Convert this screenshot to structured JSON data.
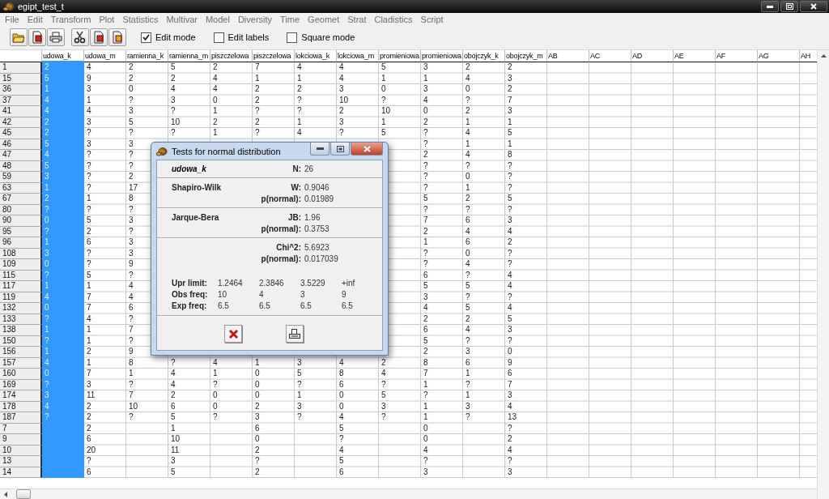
{
  "window": {
    "title": "egipt_test_t"
  },
  "menu": [
    "File",
    "Edit",
    "Transform",
    "Plot",
    "Statistics",
    "Multivar",
    "Model",
    "Diversity",
    "Time",
    "Geomet",
    "Strat",
    "Cladistics",
    "Script"
  ],
  "toolbar": {
    "checkboxes": [
      {
        "label": "Edit mode",
        "checked": true
      },
      {
        "label": "Edit labels",
        "checked": false
      },
      {
        "label": "Square mode",
        "checked": false
      }
    ]
  },
  "table": {
    "columns": [
      {
        "label": "udowa_k",
        "selected": true
      },
      {
        "label": "udowa_m",
        "selected": false
      },
      {
        "label": "ramienna_k",
        "selected": false
      },
      {
        "label": "ramienna_m",
        "selected": false
      },
      {
        "label": "piszczelowa",
        "selected": false
      },
      {
        "label": "piszczelowa",
        "selected": false
      },
      {
        "label": "lokciowa_k",
        "selected": false
      },
      {
        "label": "lokciowa_m",
        "selected": false
      },
      {
        "label": "promieniowa",
        "selected": false
      },
      {
        "label": "promieniowa",
        "selected": false
      },
      {
        "label": "obojczyk_k",
        "selected": false
      },
      {
        "label": "obojczyk_m",
        "selected": false
      },
      {
        "label": "AB",
        "selected": false
      },
      {
        "label": "AC",
        "selected": false
      },
      {
        "label": "AD",
        "selected": false
      },
      {
        "label": "AE",
        "selected": false
      },
      {
        "label": "AF",
        "selected": false
      },
      {
        "label": "AG",
        "selected": false
      },
      {
        "label": "AH",
        "selected": false
      }
    ],
    "rows": [
      {
        "label": "1",
        "cells": [
          "2",
          "4",
          "2",
          "5",
          "2",
          "7",
          "4",
          "4",
          "5",
          "3",
          "2",
          "2"
        ]
      },
      {
        "label": "15",
        "cells": [
          "5",
          "9",
          "2",
          "2",
          "4",
          "1",
          "1",
          "4",
          "1",
          "1",
          "4",
          "3"
        ]
      },
      {
        "label": "36",
        "cells": [
          "1",
          "3",
          "0",
          "4",
          "4",
          "2",
          "2",
          "3",
          "0",
          "3",
          "0",
          "2"
        ]
      },
      {
        "label": "37",
        "cells": [
          "4",
          "1",
          "?",
          "3",
          "0",
          "2",
          "?",
          "10",
          "?",
          "4",
          "?",
          "7"
        ]
      },
      {
        "label": "41",
        "cells": [
          "4",
          "4",
          "3",
          "?",
          "1",
          "?",
          "?",
          "2",
          "10",
          "0",
          "2",
          "3"
        ]
      },
      {
        "label": "42",
        "cells": [
          "2",
          "3",
          "5",
          "10",
          "2",
          "2",
          "1",
          "3",
          "1",
          "2",
          "1",
          "1"
        ]
      },
      {
        "label": "45",
        "cells": [
          "2",
          "?",
          "?",
          "?",
          "1",
          "?",
          "4",
          "?",
          "5",
          "?",
          "4",
          "5"
        ]
      },
      {
        "label": "46",
        "cells": [
          "5",
          "3",
          "3",
          null,
          null,
          null,
          null,
          null,
          null,
          "?",
          "1",
          "1"
        ]
      },
      {
        "label": "47",
        "cells": [
          "4",
          "?",
          "?",
          null,
          null,
          null,
          null,
          null,
          null,
          "2",
          "4",
          "8"
        ]
      },
      {
        "label": "48",
        "cells": [
          "5",
          "?",
          "?",
          null,
          null,
          null,
          null,
          null,
          null,
          "?",
          "?",
          "?"
        ]
      },
      {
        "label": "59",
        "cells": [
          "3",
          "?",
          "2",
          null,
          null,
          null,
          null,
          null,
          null,
          "?",
          "0",
          "?"
        ]
      },
      {
        "label": "63",
        "cells": [
          "1",
          "?",
          "17",
          null,
          null,
          null,
          null,
          null,
          null,
          "?",
          "1",
          "?"
        ]
      },
      {
        "label": "67",
        "cells": [
          "2",
          "1",
          "8",
          null,
          null,
          null,
          null,
          null,
          null,
          "5",
          "2",
          "5"
        ]
      },
      {
        "label": "80",
        "cells": [
          "?",
          "?",
          "?",
          null,
          null,
          null,
          null,
          null,
          null,
          "?",
          "?",
          "?"
        ]
      },
      {
        "label": "90",
        "cells": [
          "0",
          "5",
          "3",
          null,
          null,
          null,
          null,
          null,
          null,
          "7",
          "6",
          "3"
        ]
      },
      {
        "label": "95",
        "cells": [
          "?",
          "2",
          "?",
          null,
          null,
          null,
          null,
          null,
          null,
          "2",
          "4",
          "4"
        ]
      },
      {
        "label": "96",
        "cells": [
          "1",
          "6",
          "3",
          null,
          null,
          null,
          null,
          null,
          null,
          "1",
          "6",
          "2"
        ]
      },
      {
        "label": "108",
        "cells": [
          "3",
          "?",
          "3",
          null,
          null,
          null,
          null,
          null,
          null,
          "?",
          "0",
          "?"
        ]
      },
      {
        "label": "109",
        "cells": [
          "0",
          "?",
          "9",
          null,
          null,
          null,
          null,
          null,
          null,
          "?",
          "4",
          "?"
        ]
      },
      {
        "label": "115",
        "cells": [
          "?",
          "5",
          "?",
          null,
          null,
          null,
          null,
          null,
          null,
          "6",
          "?",
          "4"
        ]
      },
      {
        "label": "117",
        "cells": [
          "1",
          "1",
          "4",
          null,
          null,
          null,
          null,
          null,
          null,
          "5",
          "5",
          "4"
        ]
      },
      {
        "label": "119",
        "cells": [
          "4",
          "7",
          "4",
          null,
          null,
          null,
          null,
          null,
          null,
          "3",
          "?",
          "?"
        ]
      },
      {
        "label": "132",
        "cells": [
          "0",
          "7",
          "6",
          null,
          null,
          null,
          null,
          null,
          null,
          "4",
          "5",
          "4"
        ]
      },
      {
        "label": "133",
        "cells": [
          "?",
          "4",
          "?",
          null,
          null,
          null,
          null,
          null,
          null,
          "2",
          "2",
          "5"
        ]
      },
      {
        "label": "138",
        "cells": [
          "1",
          "1",
          "7",
          null,
          null,
          null,
          null,
          null,
          null,
          "6",
          "4",
          "3"
        ]
      },
      {
        "label": "150",
        "cells": [
          "?",
          "1",
          "?",
          null,
          null,
          null,
          null,
          null,
          null,
          "5",
          "?",
          "?"
        ]
      },
      {
        "label": "156",
        "cells": [
          "1",
          "2",
          "9",
          null,
          null,
          null,
          null,
          null,
          null,
          "2",
          "3",
          "0"
        ]
      },
      {
        "label": "157",
        "cells": [
          "4",
          "1",
          "8",
          "?",
          "4",
          "1",
          "3",
          "4",
          "2",
          "8",
          "6",
          "9"
        ]
      },
      {
        "label": "160",
        "cells": [
          "0",
          "7",
          "1",
          "4",
          "1",
          "0",
          "5",
          "8",
          "4",
          "7",
          "1",
          "6"
        ]
      },
      {
        "label": "169",
        "cells": [
          "?",
          "3",
          "?",
          "4",
          "?",
          "0",
          "?",
          "6",
          "?",
          "1",
          "?",
          "7"
        ]
      },
      {
        "label": "174",
        "cells": [
          "3",
          "11",
          "7",
          "2",
          "0",
          "0",
          "1",
          "0",
          "5",
          "?",
          "1",
          "3"
        ]
      },
      {
        "label": "178",
        "cells": [
          "4",
          "2",
          "10",
          "6",
          "0",
          "2",
          "3",
          "0",
          "3",
          "1",
          "3",
          "4"
        ]
      },
      {
        "label": "187",
        "cells": [
          "?",
          "2",
          "?",
          "5",
          "?",
          "3",
          "?",
          "4",
          "?",
          "1",
          "?",
          "13"
        ]
      },
      {
        "label": "7",
        "cells": [
          null,
          "2",
          null,
          "1",
          null,
          "6",
          null,
          "5",
          null,
          "0",
          null,
          "?"
        ]
      },
      {
        "label": "9",
        "cells": [
          null,
          "6",
          null,
          "10",
          null,
          "0",
          null,
          "?",
          null,
          "0",
          null,
          "2"
        ]
      },
      {
        "label": "10",
        "cells": [
          null,
          "20",
          null,
          "11",
          null,
          "2",
          null,
          "4",
          null,
          "4",
          null,
          "4"
        ]
      },
      {
        "label": "13",
        "cells": [
          null,
          "?",
          null,
          "3",
          null,
          "?",
          null,
          "5",
          null,
          "?",
          null,
          "?"
        ]
      },
      {
        "label": "14",
        "cells": [
          null,
          "6",
          null,
          "5",
          null,
          "2",
          null,
          "6",
          null,
          "3",
          null,
          "3"
        ]
      }
    ]
  },
  "dialog": {
    "title": "Tests for normal distribution",
    "variable": "udowa_k",
    "n_label": "N:",
    "n_value": "26",
    "sections": [
      {
        "name": "Shapiro-Wilk",
        "stats": [
          {
            "label": "W:",
            "value": "0.9046"
          },
          {
            "label": "p(normal):",
            "value": "0.01989"
          }
        ]
      },
      {
        "name": "Jarque-Bera",
        "stats": [
          {
            "label": "JB:",
            "value": "1.96"
          },
          {
            "label": "p(normal):",
            "value": "0.3753"
          }
        ]
      },
      {
        "stats": [
          {
            "label": "Chi^2:",
            "value": "5.6923"
          },
          {
            "label": "p(normal):",
            "value": "0.017039"
          }
        ],
        "frequencies": [
          {
            "label": "Upr limit:",
            "values": [
              "1.2464",
              "2.3846",
              "3.5229",
              "+inf"
            ]
          },
          {
            "label": "Obs freq:",
            "values": [
              "10",
              "4",
              "3",
              "9"
            ]
          },
          {
            "label": "Exp freq:",
            "values": [
              "6.5",
              "6.5",
              "6.5",
              "6.5"
            ]
          }
        ]
      }
    ]
  }
}
